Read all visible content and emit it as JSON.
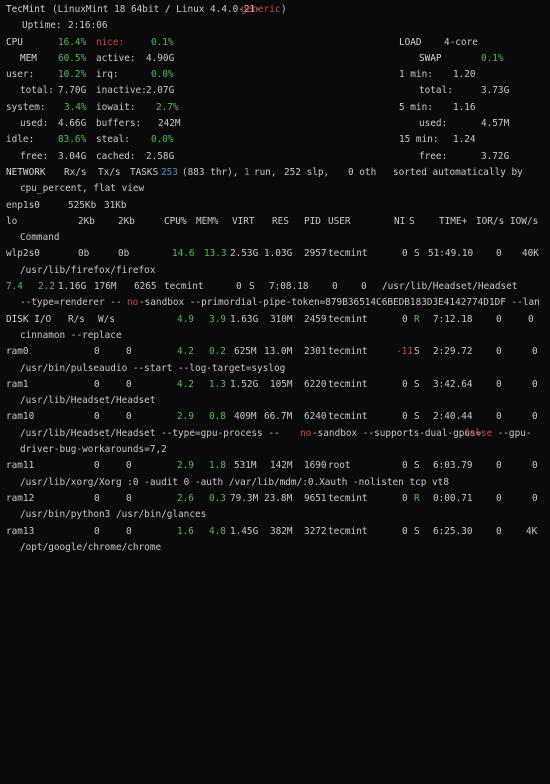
{
  "colors": {
    "background": "#0a0a0a",
    "text": "#c8c8c8",
    "ok": "#4fbf4f",
    "header": "#4a8fd8",
    "alert": "#d04646",
    "highlight": "#b45ad0"
  },
  "title": {
    "host": "TecMint",
    "os": "(LinuxMint 18 64bit / Linux 4.4.0-21-",
    "kernel_flavor": "generic",
    "close": ")"
  },
  "uptime": {
    "label": "Uptime:",
    "value": "2:16:06"
  },
  "cpu": {
    "label": "CPU",
    "pct": "16.4%",
    "nice_label": "nice:",
    "nice": "0.1%",
    "user_label": "user:",
    "user": "10.2%",
    "irq_label": "irq:",
    "irq": "0.0%",
    "system_label": "system:",
    "system": "3.4%",
    "iowait_label": "iowait:",
    "iowait": "2.7%",
    "idle_label": "idle:",
    "idle": "83.6%",
    "steal_label": "steal:",
    "steal": "0.0%"
  },
  "mem": {
    "label": "MEM",
    "pct": "60.5%",
    "active_label": "active:",
    "active": "4.90G",
    "total_label": "total:",
    "total": "7.70G",
    "inactive_label": "inactive:",
    "inactive": "2.07G",
    "used_label": "used:",
    "used": "4.66G",
    "buffers_label": "buffers:",
    "buffers": "242M",
    "free_label": "free:",
    "free": "3.04G",
    "cached_label": "cached:",
    "cached": "2.58G"
  },
  "load": {
    "label": "LOAD",
    "cores": "4-core",
    "m1_label": "1 min:",
    "m1": "1.20",
    "m5_label": "5 min:",
    "m5": "1.16",
    "m15_label": "15 min:",
    "m15": "1.24"
  },
  "swap": {
    "label": "SWAP",
    "pct": "0.1%",
    "total_label": "total:",
    "total": "3.73G",
    "used_label": "used:",
    "used": "4.57M",
    "free_label": "free:",
    "free": "3.72G"
  },
  "network": {
    "label": "NETWORK",
    "rx": "Rx/s",
    "tx": "Tx/s",
    "interfaces": [
      {
        "name": "enp1s0",
        "rx": "525Kb",
        "tx": "31Kb"
      },
      {
        "name": "lo",
        "rx": "2Kb",
        "tx": "2Kb"
      },
      {
        "name": "wlp2s0",
        "rx": "0b",
        "tx": "0b"
      }
    ]
  },
  "tasks": {
    "label": "TASKS",
    "total": "253",
    "thr": "(883 thr),",
    "run_n": "1",
    "run_label": "run,",
    "slp": "252 slp,",
    "oth": "0 oth",
    "sort_text": "sorted automatically by",
    "sort_key": "cpu_percent, flat view"
  },
  "disk": {
    "label": "DISK I/O",
    "r": "R/s",
    "w": "W/s",
    "devices": [
      {
        "name": "ram0",
        "r": "0",
        "w": "0"
      },
      {
        "name": "ram1",
        "r": "0",
        "w": "0"
      },
      {
        "name": "ram10",
        "r": "0",
        "w": "0"
      },
      {
        "name": "ram11",
        "r": "0",
        "w": "0"
      },
      {
        "name": "ram12",
        "r": "0",
        "w": "0"
      },
      {
        "name": "ram13",
        "r": "0",
        "w": "0"
      }
    ]
  },
  "proc_header": {
    "cpu": "CPU%",
    "mem": "MEM%",
    "virt": "VIRT",
    "res": "RES",
    "pid": "PID",
    "user": "USER",
    "ni": "NI",
    "s": "S",
    "time": "TIME+",
    "ior": "IOR/s",
    "iow": "IOW/s",
    "cmd": "Command"
  },
  "processes": [
    {
      "cpu": "14.6",
      "mem": "13.3",
      "virt": "2.53G",
      "res": "1.03G",
      "pid": "2957",
      "user": "tecmint",
      "ni": "0",
      "s": "S",
      "time": "51:49.10",
      "ior": "0",
      "iow": "40K",
      "cmd": "/usr/lib/firefox/firefox"
    },
    {
      "cpu": "7.4",
      "mem": "2.2",
      "virt": "1.16G",
      "res": "176M",
      "pid": "6265",
      "user": "tecmint",
      "ni": "0",
      "s": "S",
      "time": "7:08.18",
      "ior": "0",
      "iow": "0",
      "cmd_a": "/usr/lib/Headset/Headset",
      "cmd_b": "--type=renderer --",
      "cmd_c": "no",
      "cmd_d": "-sandbox --primordial-pipe-token=879B36514C6BEDB183D3E4142774D1DF --lan",
      "cmd_e": "cinnamon --replace"
    },
    {
      "cpu": "4.9",
      "mem": "3.9",
      "virt": "1.63G",
      "res": "310M",
      "pid": "2459",
      "user": "tecmint",
      "ni": "0",
      "s": "R",
      "time": "7:12.18",
      "ior": "0",
      "iow": "0"
    },
    {
      "cpu": "4.2",
      "mem": "0.2",
      "virt": "625M",
      "res": "13.0M",
      "pid": "2301",
      "user": "tecmint",
      "ni": "-11",
      "s": "S",
      "time": "2:29.72",
      "ior": "0",
      "iow": "0",
      "cmd": "/usr/bin/pulseaudio --start --log-target=syslog"
    },
    {
      "cpu": "4.2",
      "mem": "1.3",
      "virt": "1.52G",
      "res": "105M",
      "pid": "6220",
      "user": "tecmint",
      "ni": "0",
      "s": "S",
      "time": "3:42.64",
      "ior": "0",
      "iow": "0",
      "cmd": "/usr/lib/Headset/Headset"
    },
    {
      "cpu": "2.9",
      "mem": "0.8",
      "virt": "409M",
      "res": "66.7M",
      "pid": "6240",
      "user": "tecmint",
      "ni": "0",
      "s": "S",
      "time": "2:40.44",
      "ior": "0",
      "iow": "0",
      "cmd_a": "/usr/lib/Headset/Headset --type=gpu-process --",
      "cmd_b": "no",
      "cmd_c": "-sandbox --supports-dual-gpus=",
      "cmd_d": "false",
      "cmd_e": " --gpu-",
      "cmd_f": "driver-bug-workarounds=7,2"
    },
    {
      "cpu": "2.9",
      "mem": "1.8",
      "virt": "531M",
      "res": "142M",
      "pid": "1690",
      "user": "root",
      "ni": "0",
      "s": "S",
      "time": "6:03.79",
      "ior": "0",
      "iow": "0",
      "cmd_a": "/usr/lib/xorg/Xorg :0 -audit 0 -auth /var/lib/mdm/:0.Xauth -nolisten tcp vt8"
    },
    {
      "cpu": "2.6",
      "mem": "0.3",
      "virt": "79.3M",
      "res": "23.8M",
      "pid": "9651",
      "user": "tecmint",
      "ni": "0",
      "s": "R",
      "time": "0:00.71",
      "ior": "0",
      "iow": "0",
      "cmd": "/usr/bin/python3 /usr/bin/glances"
    },
    {
      "cpu": "1.6",
      "mem": "4.8",
      "virt": "1.45G",
      "res": "382M",
      "pid": "3272",
      "user": "tecmint",
      "ni": "0",
      "s": "S",
      "time": "6:25.30",
      "ior": "0",
      "iow": "4K",
      "cmd": "/opt/google/chrome/chrome"
    }
  ]
}
